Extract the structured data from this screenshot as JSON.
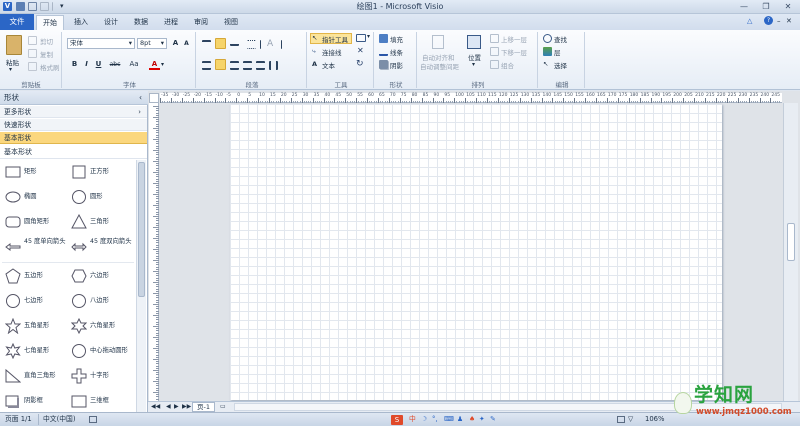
{
  "app": {
    "title": "绘图1 - Microsoft Visio"
  },
  "tabs": [
    "文件",
    "开始",
    "插入",
    "设计",
    "数据",
    "进程",
    "审阅",
    "视图"
  ],
  "ribbon": {
    "clipboard": {
      "paste": "粘贴",
      "cut": "剪切",
      "copy": "复制",
      "format_painter": "格式刷",
      "label": "剪贴板"
    },
    "font": {
      "name": "宋体",
      "size": "8pt",
      "grow": "A",
      "shrink": "A",
      "bold": "B",
      "italic": "I",
      "underline": "U",
      "strike": "abc",
      "case": "Aa",
      "color": "A",
      "label": "字体"
    },
    "paragraph": {
      "label": "段落"
    },
    "tools": {
      "pointer": "指针工具",
      "connector": "连接线",
      "text": "文本",
      "label": "工具"
    },
    "shape": {
      "fill": "填充",
      "line": "线条",
      "shadow": "阴影",
      "label": "形状"
    },
    "arrange": {
      "auto_align": "自动对齐和",
      "auto_space": "自动调整间距",
      "position": "位置",
      "bring_forward": "上移一层",
      "send_backward": "下移一层",
      "group": "组合",
      "label": "排列"
    },
    "editing": {
      "find": "查找",
      "layers": "层",
      "select": "选择",
      "label": "编辑"
    }
  },
  "shapes_panel": {
    "title": "形状",
    "more": "更多形状",
    "quick": "快速形状",
    "basic": "基本形状",
    "stencil_title": "基本形状",
    "items": [
      [
        "矩形",
        "正方形"
      ],
      [
        "椭圆",
        "圆形"
      ],
      [
        "圆角矩形",
        "三角形"
      ],
      [
        "45 度单向箭头",
        "45 度双向箭头"
      ],
      [
        "五边形",
        "六边形"
      ],
      [
        "七边形",
        "八边形"
      ],
      [
        "五角星形",
        "六角星形"
      ],
      [
        "七角星形",
        "中心拖动圆形"
      ],
      [
        "直角三角形",
        "十字形"
      ],
      [
        "阴影框",
        "三维框"
      ]
    ]
  },
  "ruler": {
    "h": [
      "-35",
      "-30",
      "-25",
      "-20",
      "-15",
      "-10",
      "-5",
      "0",
      "5",
      "10",
      "15",
      "20",
      "25",
      "30",
      "35",
      "40",
      "45",
      "50",
      "55",
      "60",
      "65",
      "70",
      "75",
      "80",
      "85",
      "90",
      "95",
      "100",
      "105",
      "110",
      "115",
      "120",
      "125",
      "130",
      "135",
      "140",
      "145",
      "150",
      "155",
      "160",
      "165",
      "170",
      "175",
      "180",
      "185",
      "190",
      "195",
      "200",
      "205",
      "210",
      "215",
      "220",
      "225",
      "230",
      "235",
      "240",
      "245"
    ]
  },
  "page_tab": "页-1",
  "status": {
    "page": "页面 1/1",
    "lang": "中文(中国)",
    "zoom": "106%"
  },
  "ime": {
    "mode": "中"
  },
  "watermark": {
    "main": "学知网",
    "url": "www.jmqz1000.com"
  }
}
